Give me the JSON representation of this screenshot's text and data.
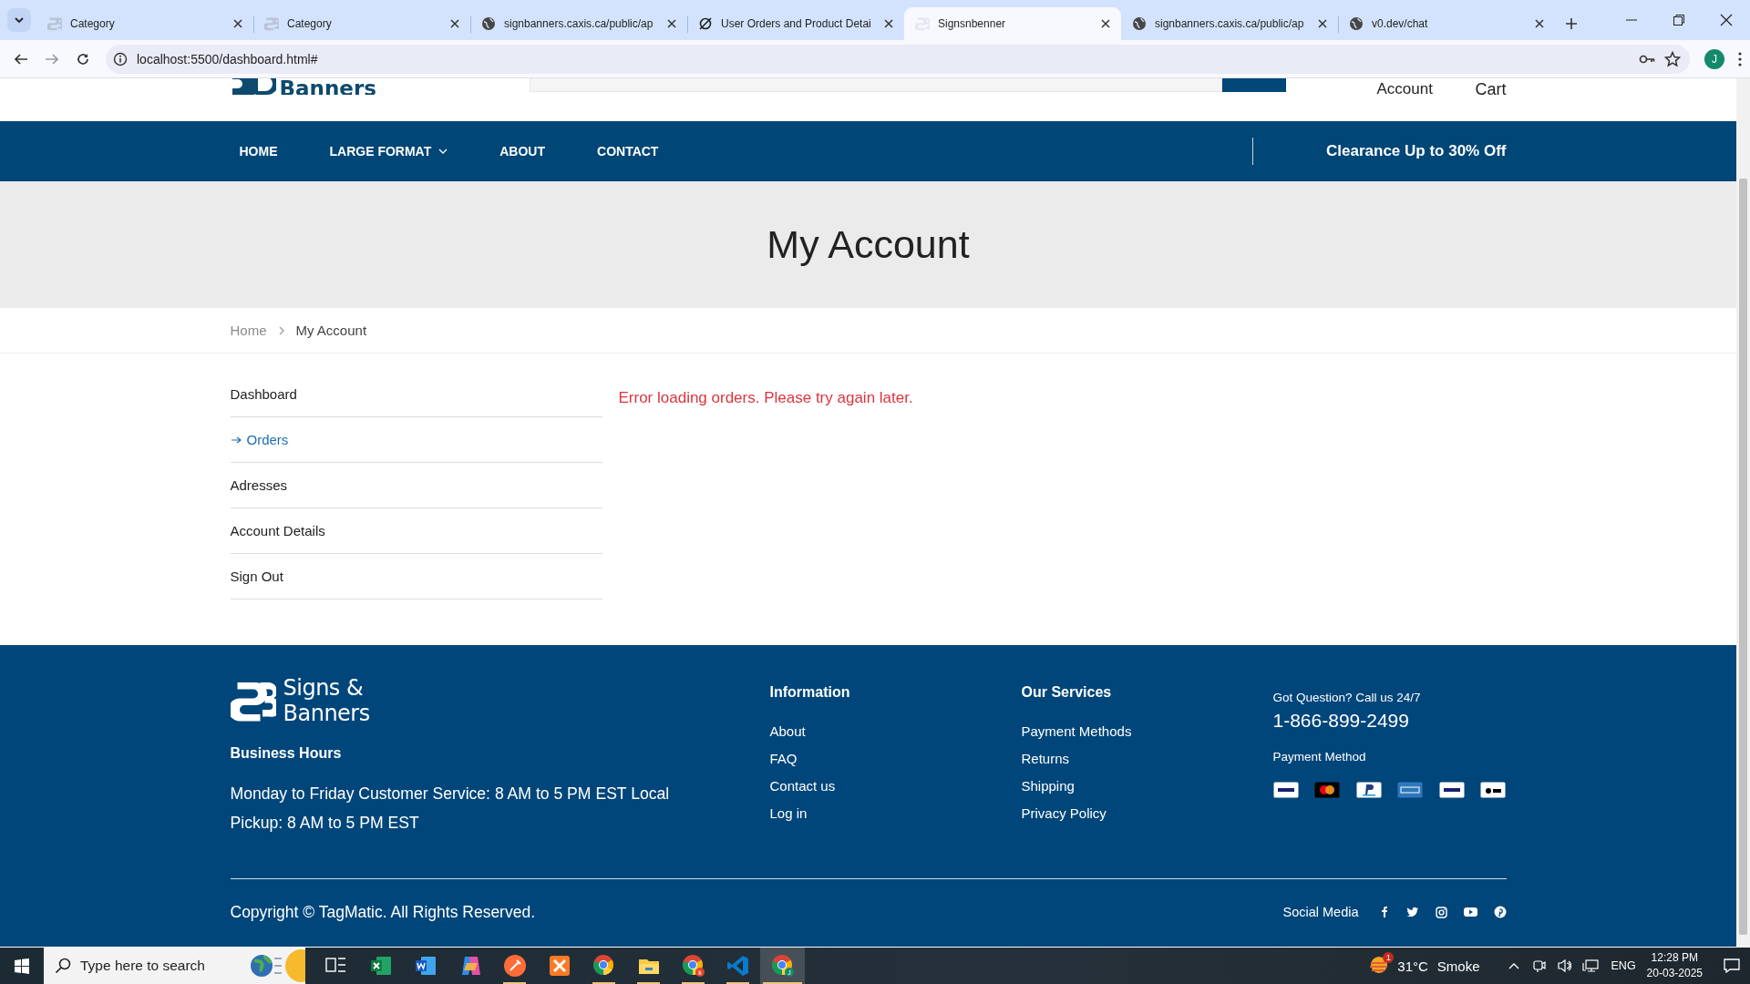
{
  "browser": {
    "tabs": [
      {
        "title": "Category",
        "kind": "logo",
        "selected": false
      },
      {
        "title": "Category",
        "kind": "logo",
        "selected": false
      },
      {
        "title": "signbanners.caxis.ca/public/ap",
        "kind": "globe",
        "selected": false
      },
      {
        "title": "User Orders and Product Detai",
        "kind": "slash",
        "selected": false
      },
      {
        "title": "Signsnbenner",
        "kind": "logo",
        "selected": true
      },
      {
        "title": "signbanners.caxis.ca/public/ap",
        "kind": "globe",
        "selected": false
      },
      {
        "title": "v0.dev/chat",
        "kind": "globe",
        "selected": false
      }
    ],
    "url": "localhost:5500/dashboard.html#",
    "profile_initial": "J"
  },
  "header": {
    "logo_text": "Banners",
    "account": "Account",
    "cart": "Cart"
  },
  "nav": {
    "items": [
      {
        "label": "HOME",
        "dropdown": false
      },
      {
        "label": "LARGE FORMAT",
        "dropdown": true
      },
      {
        "label": "ABOUT",
        "dropdown": false
      },
      {
        "label": "CONTACT",
        "dropdown": false
      }
    ],
    "promo": "Clearance Up to 30% Off"
  },
  "hero": {
    "title": "My Account"
  },
  "breadcrumb": [
    {
      "label": "Home",
      "current": false
    },
    {
      "label": "My Account",
      "current": true
    }
  ],
  "sidebar": {
    "items": [
      {
        "label": "Dashboard",
        "selected": false
      },
      {
        "label": "Orders",
        "selected": true
      },
      {
        "label": "Adresses",
        "selected": false
      },
      {
        "label": "Account Details",
        "selected": false
      },
      {
        "label": "Sign Out",
        "selected": false
      }
    ]
  },
  "error_message": "Error loading orders. Please try again later.",
  "footer": {
    "logo_lines": [
      "Signs &",
      "Banners"
    ],
    "hours_title": "Business Hours",
    "hours_text": "Monday to Friday Customer Service: 8 AM to 5 PM EST Local Pickup: 8 AM to 5 PM EST",
    "columns": [
      {
        "title": "Information",
        "links": [
          "About",
          "FAQ",
          "Contact us",
          "Log in"
        ]
      },
      {
        "title": "Our Services",
        "links": [
          "Payment Methods",
          "Returns",
          "Shipping",
          "Privacy Policy"
        ]
      }
    ],
    "call_label": "Got Question? Call us 24/7",
    "phone": "1-866-899-2499",
    "payment_label": "Payment Method",
    "payment_cards": [
      {
        "kind": "visa"
      },
      {
        "kind": "mastercard"
      },
      {
        "kind": "paypal"
      },
      {
        "kind": "amex"
      },
      {
        "kind": "visa"
      },
      {
        "kind": "applepay"
      }
    ],
    "copyright": "Copyright © TagMatic. All Rights Reserved.",
    "social_label": "Social Media",
    "social": [
      {
        "kind": "facebook"
      },
      {
        "kind": "twitter"
      },
      {
        "kind": "instagram"
      },
      {
        "kind": "youtube"
      },
      {
        "kind": "pinterest"
      }
    ]
  },
  "taskbar": {
    "search_placeholder": "Type here to search",
    "apps": [
      {
        "kind": "taskview",
        "running": false,
        "active": false
      },
      {
        "kind": "excel",
        "running": false,
        "active": false
      },
      {
        "kind": "word",
        "running": false,
        "active": false
      },
      {
        "kind": "copilot",
        "running": false,
        "active": false
      },
      {
        "kind": "postman",
        "running": true,
        "active": false
      },
      {
        "kind": "xampp",
        "running": false,
        "active": false
      },
      {
        "kind": "chrome",
        "running": true,
        "active": false
      },
      {
        "kind": "files",
        "running": true,
        "active": false
      },
      {
        "kind": "chrome",
        "badge": "k",
        "running": true,
        "active": false
      },
      {
        "kind": "vscode",
        "running": true,
        "active": false
      },
      {
        "kind": "chrome",
        "badge": "J",
        "running": true,
        "active": true
      }
    ],
    "weather_badge": "1",
    "temperature": "31°C",
    "weather": "Smoke",
    "language": "ENG",
    "time": "12:28 PM",
    "date": "20-03-2025"
  }
}
